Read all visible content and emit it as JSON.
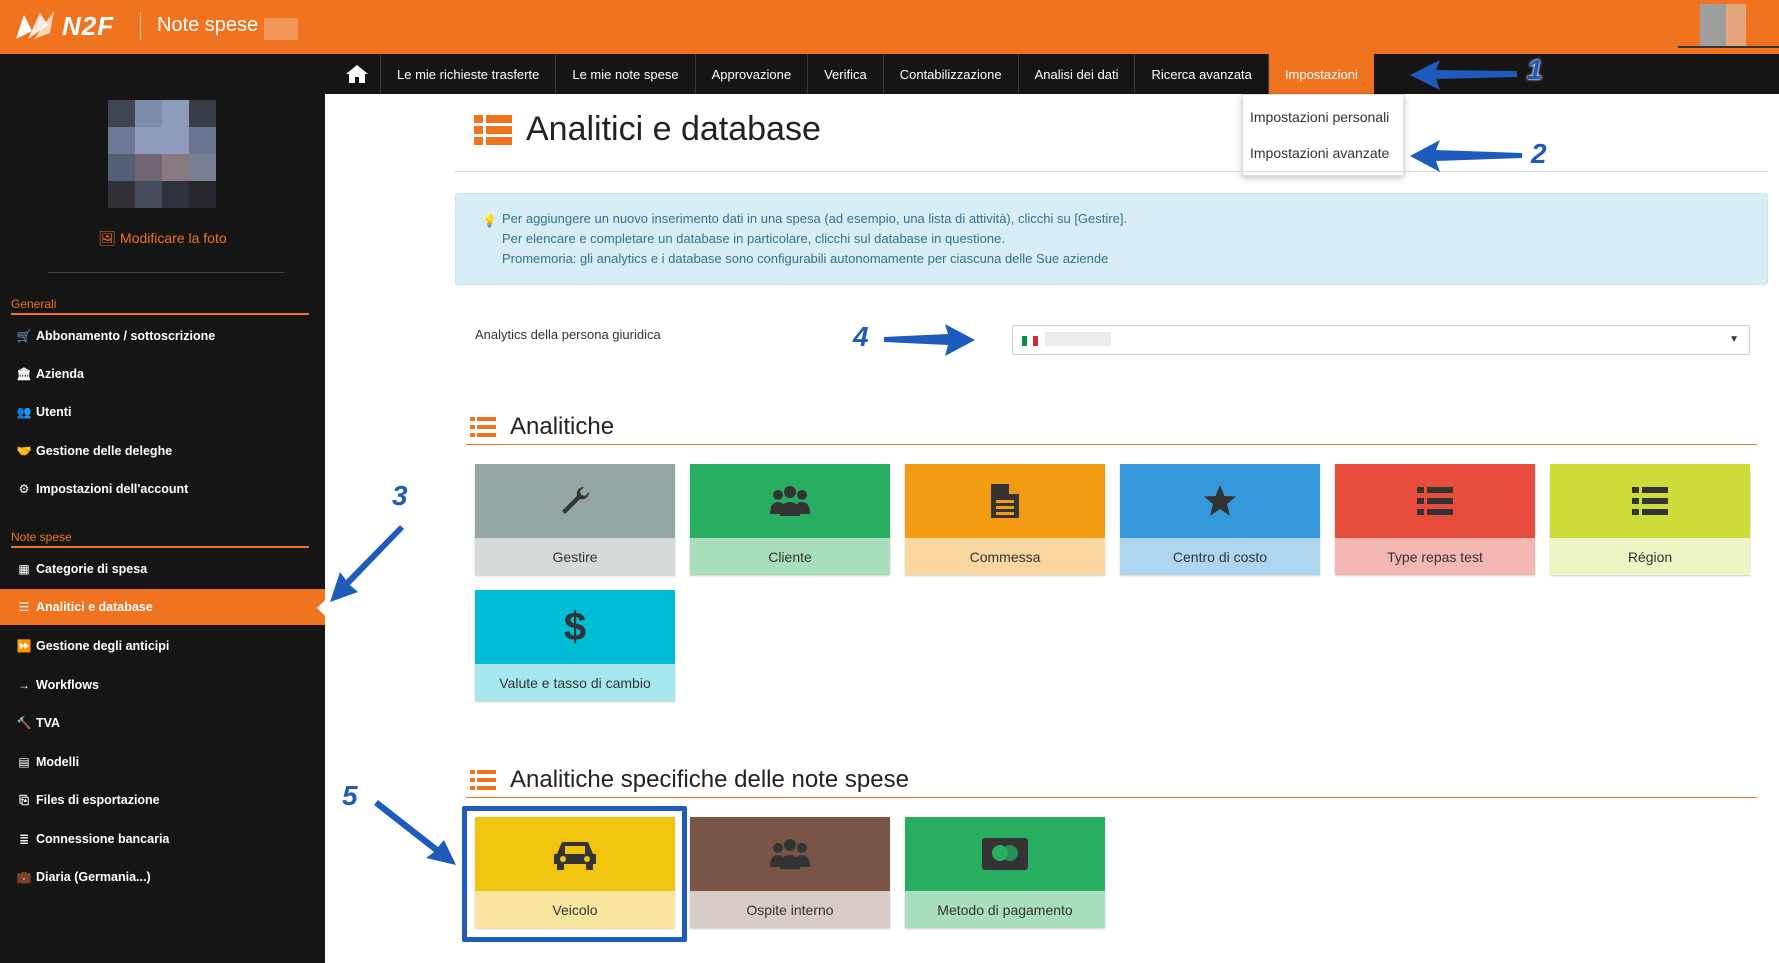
{
  "header": {
    "logo_text": "N2F",
    "app_title": "Note spese"
  },
  "nav": {
    "items": [
      {
        "label": "Le mie richieste trasferte"
      },
      {
        "label": "Le mie note spese"
      },
      {
        "label": "Approvazione"
      },
      {
        "label": "Verifica"
      },
      {
        "label": "Contabilizzazione"
      },
      {
        "label": "Analisi dei dati"
      },
      {
        "label": "Ricerca avanzata"
      },
      {
        "label": "Impostazioni",
        "active": true
      }
    ],
    "dropdown": [
      "Impostazioni personali",
      "Impostazioni avanzate"
    ]
  },
  "sidebar": {
    "edit_photo": "Modificare la foto",
    "sections": [
      {
        "title": "Generali",
        "items": [
          {
            "label": "Abbonamento / sottoscrizione",
            "icon": "cart-icon"
          },
          {
            "label": "Azienda",
            "icon": "bank-icon"
          },
          {
            "label": "Utenti",
            "icon": "users-icon"
          },
          {
            "label": "Gestione delle deleghe",
            "icon": "handshake-icon"
          },
          {
            "label": "Impostazioni dell'account",
            "icon": "gears-icon"
          }
        ]
      },
      {
        "title": "Note spese",
        "items": [
          {
            "label": "Categorie di spesa",
            "icon": "grid-icon"
          },
          {
            "label": "Analitici e database",
            "icon": "list-icon",
            "active": true
          },
          {
            "label": "Gestione degli anticipi",
            "icon": "forward-icon"
          },
          {
            "label": "Workflows",
            "icon": "arrow-right-icon"
          },
          {
            "label": "TVA",
            "icon": "gavel-icon"
          },
          {
            "label": "Modelli",
            "icon": "template-icon"
          },
          {
            "label": "Files di esportazione",
            "icon": "files-icon"
          },
          {
            "label": "Connessione bancaria",
            "icon": "database-icon"
          },
          {
            "label": "Diaria (Germania...)",
            "icon": "briefcase-icon"
          }
        ]
      }
    ]
  },
  "main": {
    "page_title": "Analitici e database",
    "info_lines": [
      "Per aggiungere un nuovo inserimento dati in una spesa (ad esempio, una lista di attività), clicchi su [Gestire].",
      "Per elencare e completare un database in particolare, clicchi sul database in questione.",
      "Promemoria: gli analytics e i database sono configurabili autonomamente per ciascuna delle Sue aziende"
    ],
    "entity_label": "Analytics della persona giuridica",
    "section_analytics": "Analitiche",
    "analytics_tiles": [
      {
        "label": "Gestire",
        "icon": "wrench-icon",
        "color": "#95a5a6",
        "light": "#d5dbdb"
      },
      {
        "label": "Cliente",
        "icon": "users-icon",
        "color": "#27ae60",
        "light": "#a9dfbf"
      },
      {
        "label": "Commessa",
        "icon": "document-icon",
        "color": "#f39c12",
        "light": "#fad7a0"
      },
      {
        "label": "Centro di costo",
        "icon": "star-icon",
        "color": "#3498db",
        "light": "#aed6f1"
      },
      {
        "label": "Type repas test",
        "icon": "list-icon",
        "color": "#e74c3c",
        "light": "#f5b7b1"
      },
      {
        "label": "Région",
        "icon": "list-icon",
        "color": "#cddc39",
        "light": "#eff4c4"
      },
      {
        "label": "Valute e tasso di cambio",
        "icon": "dollar-icon",
        "color": "#00bcd4",
        "light": "#a6e8f0"
      }
    ],
    "section_specific": "Analitiche specifiche delle note spese",
    "specific_tiles": [
      {
        "label": "Veicolo",
        "icon": "car-icon",
        "color": "#f1c40f",
        "light": "#f9e79f"
      },
      {
        "label": "Ospite interno",
        "icon": "users-icon",
        "color": "#795548",
        "light": "#d7ccc8"
      },
      {
        "label": "Metodo di pagamento",
        "icon": "credit-card-icon",
        "color": "#27ae60",
        "light": "#a9dfbf"
      }
    ]
  },
  "annotations": [
    "1",
    "2",
    "3",
    "4",
    "5"
  ]
}
